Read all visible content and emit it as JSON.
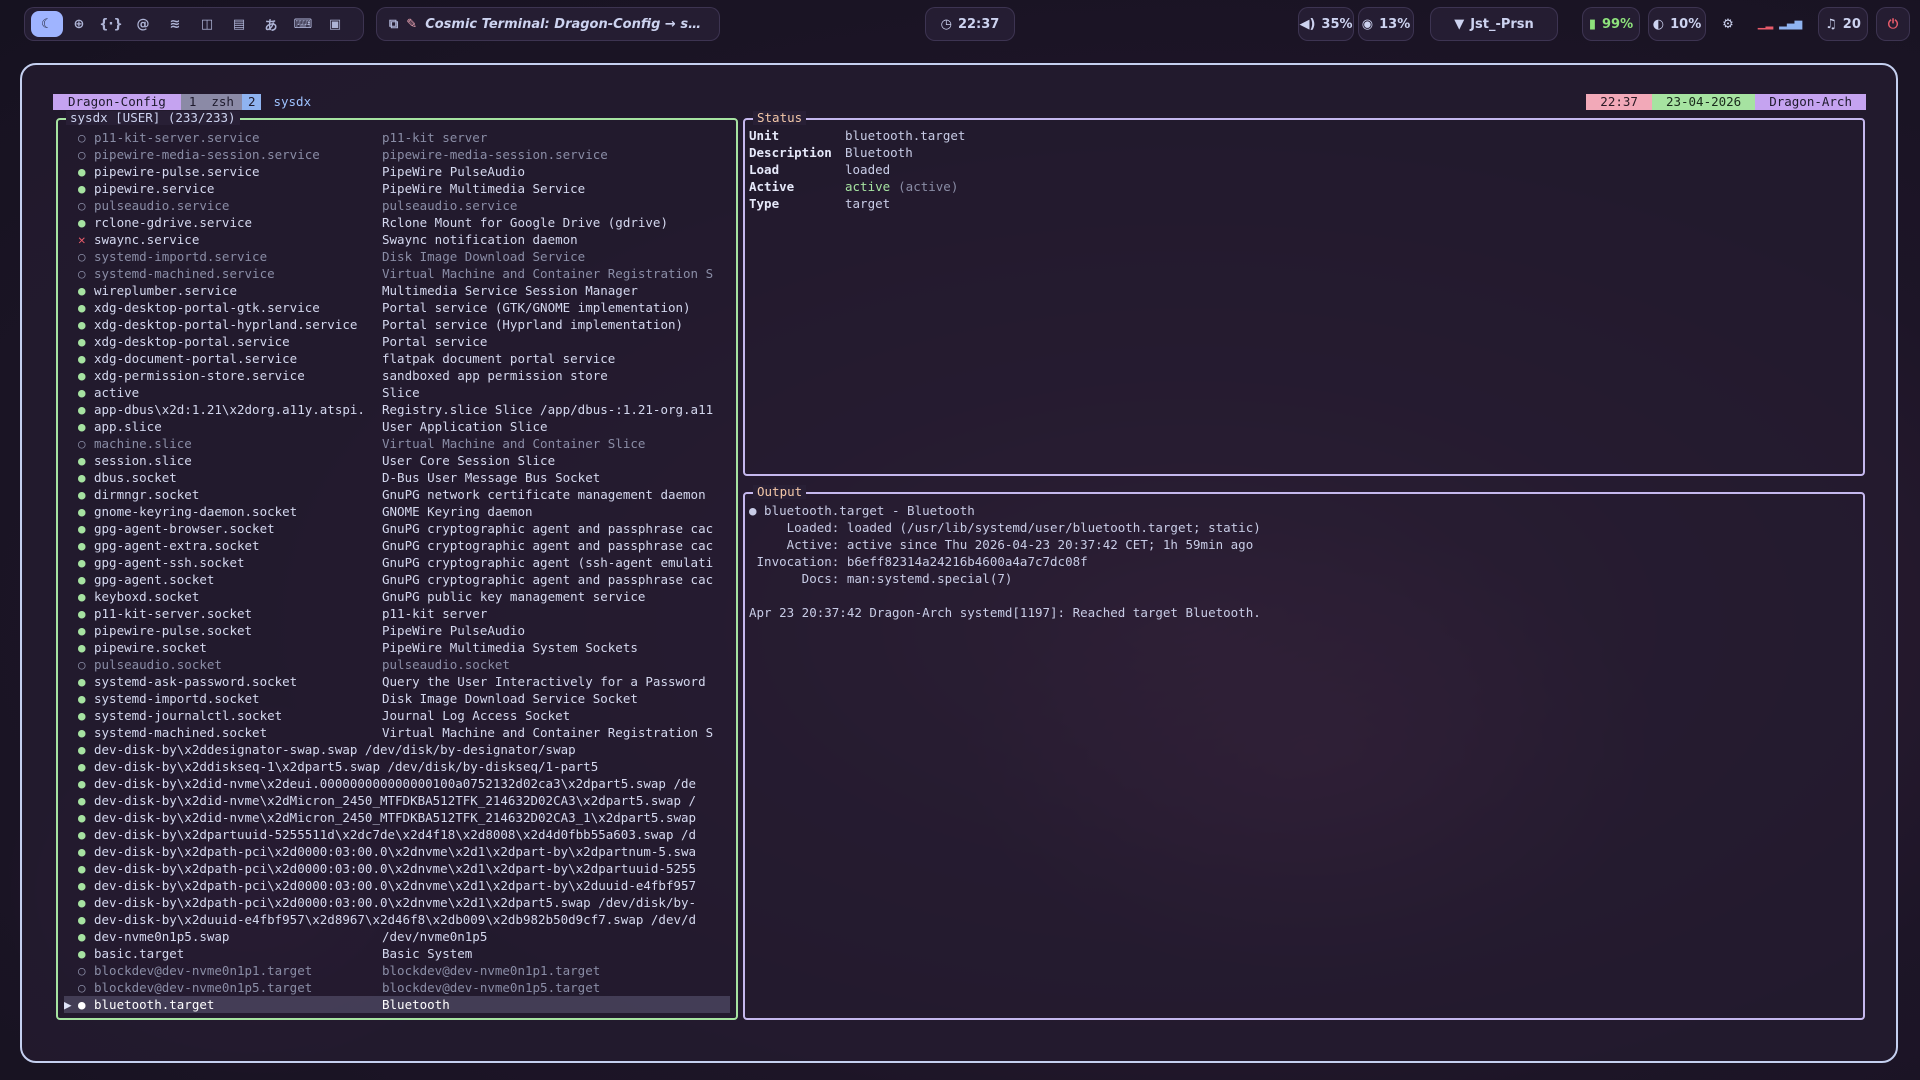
{
  "topbar": {
    "workspaces": [
      {
        "icon": "moon-icon",
        "glyph": "☾",
        "active": true
      },
      {
        "icon": "globe-icon",
        "glyph": "⊕"
      },
      {
        "icon": "code-icon",
        "glyph": "{·}"
      },
      {
        "icon": "spiral-icon",
        "glyph": "@"
      },
      {
        "icon": "layers-icon",
        "glyph": "≋"
      },
      {
        "icon": "sound-icon",
        "glyph": "◫"
      },
      {
        "icon": "file-icon",
        "glyph": "▤"
      },
      {
        "icon": "translate-icon",
        "glyph": "あ"
      },
      {
        "icon": "keyboard-icon",
        "glyph": "⌨"
      },
      {
        "icon": "note-icon",
        "glyph": "▣"
      }
    ],
    "window_title": "Cosmic Terminal: Dragon-Config → s…",
    "clock": "22:37",
    "volume": "35%",
    "cpu": "13%",
    "network": "Jst_-Prsn",
    "battery": "99%",
    "brightness": "10%",
    "notifications": "20"
  },
  "tmux": {
    "session": "Dragon-Config",
    "win1_num": "1",
    "win1_name": "zsh",
    "win2_num": "2",
    "win2_name": "sysdx",
    "time": "22:37",
    "date": "23-04-2026",
    "host": "Dragon-Arch"
  },
  "left_panel": {
    "title": "sysdx [USER] (233/233)",
    "units": [
      {
        "s": "inactive",
        "name": "p11-kit-server.service",
        "desc": "p11-kit server"
      },
      {
        "s": "inactive",
        "name": "pipewire-media-session.service",
        "desc": "pipewire-media-session.service"
      },
      {
        "s": "active",
        "name": "pipewire-pulse.service",
        "desc": "PipeWire PulseAudio"
      },
      {
        "s": "active",
        "name": "pipewire.service",
        "desc": "PipeWire Multimedia Service"
      },
      {
        "s": "inactive",
        "name": "pulseaudio.service",
        "desc": "pulseaudio.service"
      },
      {
        "s": "active",
        "name": "rclone-gdrive.service",
        "desc": "Rclone Mount for Google Drive (gdrive)"
      },
      {
        "s": "failed",
        "name": "swaync.service",
        "desc": "Swaync notification daemon"
      },
      {
        "s": "inactive",
        "name": "systemd-importd.service",
        "desc": "Disk Image Download Service"
      },
      {
        "s": "inactive",
        "name": "systemd-machined.service",
        "desc": "Virtual Machine and Container Registration S"
      },
      {
        "s": "active",
        "name": "wireplumber.service",
        "desc": "Multimedia Service Session Manager"
      },
      {
        "s": "active",
        "name": "xdg-desktop-portal-gtk.service",
        "desc": "Portal service (GTK/GNOME implementation)"
      },
      {
        "s": "active",
        "name": "xdg-desktop-portal-hyprland.service",
        "desc": "Portal service (Hyprland implementation)"
      },
      {
        "s": "active",
        "name": "xdg-desktop-portal.service",
        "desc": "Portal service"
      },
      {
        "s": "active",
        "name": "xdg-document-portal.service",
        "desc": "flatpak document portal service"
      },
      {
        "s": "active",
        "name": "xdg-permission-store.service",
        "desc": "sandboxed app permission store"
      },
      {
        "s": "active",
        "name": "active",
        "desc": "Slice"
      },
      {
        "s": "active",
        "name": "app-dbus\\x2d:1.21\\x2dorg.a11y.atspi.",
        "desc": "Registry.slice Slice /app/dbus-:1.21-org.a11"
      },
      {
        "s": "active",
        "name": "app.slice",
        "desc": "User Application Slice"
      },
      {
        "s": "inactive",
        "name": "machine.slice",
        "desc": "Virtual Machine and Container Slice"
      },
      {
        "s": "active",
        "name": "session.slice",
        "desc": "User Core Session Slice"
      },
      {
        "s": "active",
        "name": "dbus.socket",
        "desc": "D-Bus User Message Bus Socket"
      },
      {
        "s": "active",
        "name": "dirmngr.socket",
        "desc": "GnuPG network certificate management daemon"
      },
      {
        "s": "active",
        "name": "gnome-keyring-daemon.socket",
        "desc": "GNOME Keyring daemon"
      },
      {
        "s": "active",
        "name": "gpg-agent-browser.socket",
        "desc": "GnuPG cryptographic agent and passphrase cac"
      },
      {
        "s": "active",
        "name": "gpg-agent-extra.socket",
        "desc": "GnuPG cryptographic agent and passphrase cac"
      },
      {
        "s": "active",
        "name": "gpg-agent-ssh.socket",
        "desc": "GnuPG cryptographic agent (ssh-agent emulati"
      },
      {
        "s": "active",
        "name": "gpg-agent.socket",
        "desc": "GnuPG cryptographic agent and passphrase cac"
      },
      {
        "s": "active",
        "name": "keyboxd.socket",
        "desc": "GnuPG public key management service"
      },
      {
        "s": "active",
        "name": "p11-kit-server.socket",
        "desc": "p11-kit server"
      },
      {
        "s": "active",
        "name": "pipewire-pulse.socket",
        "desc": "PipeWire PulseAudio"
      },
      {
        "s": "active",
        "name": "pipewire.socket",
        "desc": "PipeWire Multimedia System Sockets"
      },
      {
        "s": "inactive",
        "name": "pulseaudio.socket",
        "desc": "pulseaudio.socket"
      },
      {
        "s": "active",
        "name": "systemd-ask-password.socket",
        "desc": "Query the User Interactively for a Password"
      },
      {
        "s": "active",
        "name": "systemd-importd.socket",
        "desc": "Disk Image Download Service Socket"
      },
      {
        "s": "active",
        "name": "systemd-journalctl.socket",
        "desc": "Journal Log Access Socket"
      },
      {
        "s": "active",
        "name": "systemd-machined.socket",
        "desc": "Virtual Machine and Container Registration S"
      },
      {
        "s": "active",
        "full": "dev-disk-by\\x2ddesignator-swap.swap /dev/disk/by-designator/swap"
      },
      {
        "s": "active",
        "full": "dev-disk-by\\x2ddiskseq-1\\x2dpart5.swap /dev/disk/by-diskseq/1-part5"
      },
      {
        "s": "active",
        "full": "dev-disk-by\\x2did-nvme\\x2deui.000000000000000100a0752132d02ca3\\x2dpart5.swap /de"
      },
      {
        "s": "active",
        "full": "dev-disk-by\\x2did-nvme\\x2dMicron_2450_MTFDKBA512TFK_214632D02CA3\\x2dpart5.swap /"
      },
      {
        "s": "active",
        "full": "dev-disk-by\\x2did-nvme\\x2dMicron_2450_MTFDKBA512TFK_214632D02CA3_1\\x2dpart5.swap"
      },
      {
        "s": "active",
        "full": "dev-disk-by\\x2dpartuuid-5255511d\\x2dc7de\\x2d4f18\\x2d8008\\x2d4d0fbb55a603.swap /d"
      },
      {
        "s": "active",
        "full": "dev-disk-by\\x2dpath-pci\\x2d0000:03:00.0\\x2dnvme\\x2d1\\x2dpart-by\\x2dpartnum-5.swa"
      },
      {
        "s": "active",
        "full": "dev-disk-by\\x2dpath-pci\\x2d0000:03:00.0\\x2dnvme\\x2d1\\x2dpart-by\\x2dpartuuid-5255"
      },
      {
        "s": "active",
        "full": "dev-disk-by\\x2dpath-pci\\x2d0000:03:00.0\\x2dnvme\\x2d1\\x2dpart-by\\x2duuid-e4fbf957"
      },
      {
        "s": "active",
        "full": "dev-disk-by\\x2dpath-pci\\x2d0000:03:00.0\\x2dnvme\\x2d1\\x2dpart5.swap /dev/disk/by-"
      },
      {
        "s": "active",
        "full": "dev-disk-by\\x2duuid-e4fbf957\\x2d8967\\x2d46f8\\x2db009\\x2db982b50d9cf7.swap /dev/d"
      },
      {
        "s": "active",
        "name": "dev-nvme0n1p5.swap",
        "desc": "/dev/nvme0n1p5"
      },
      {
        "s": "active",
        "name": "basic.target",
        "desc": "Basic System"
      },
      {
        "s": "inactive",
        "name": "blockdev@dev-nvme0n1p1.target",
        "desc": "blockdev@dev-nvme0n1p1.target"
      },
      {
        "s": "inactive",
        "name": "blockdev@dev-nvme0n1p5.target",
        "desc": "blockdev@dev-nvme0n1p5.target"
      },
      {
        "s": "active",
        "name": "bluetooth.target",
        "desc": "Bluetooth",
        "selected": true
      }
    ]
  },
  "status_panel": {
    "title": "Status",
    "rows": [
      {
        "key": "Unit",
        "value": "bluetooth.target"
      },
      {
        "key": "Description",
        "value": "Bluetooth"
      },
      {
        "key": "Load",
        "value": "loaded"
      },
      {
        "key": "Active",
        "value": "active",
        "sub": "(active)"
      },
      {
        "key": "Type",
        "value": "target"
      }
    ]
  },
  "output_panel": {
    "title": "Output",
    "lines": [
      "● bluetooth.target - Bluetooth",
      "     Loaded: loaded (/usr/lib/systemd/user/bluetooth.target; static)",
      "     Active: active since Thu 2026-04-23 20:37:42 CET; 1h 59min ago",
      " Invocation: b6eff82314a24216b4600a4a7c7dc08f",
      "       Docs: man:systemd.special(7)",
      "",
      "Apr 23 20:37:42 Dragon-Arch systemd[1197]: Reached target Bluetooth."
    ]
  },
  "colors": {
    "active_dot": "#a6e3a1",
    "inactive_dot": "#8a8da6",
    "failed_dot": "#e85b6a",
    "panel_border_left": "#a6e3a1",
    "panel_border_right": "#c5b8ee",
    "window_border": "#c5d0f0"
  }
}
